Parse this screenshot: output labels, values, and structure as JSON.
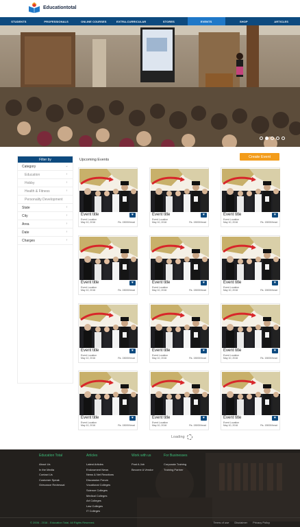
{
  "brand": {
    "name": "Educationtotal"
  },
  "nav": {
    "items": [
      {
        "label": "STUDENTS"
      },
      {
        "label": "PROFESSIONALS"
      },
      {
        "label": "ONLINE COURSES"
      },
      {
        "label": "EXTRA-CURRICULAR"
      },
      {
        "label": "STORES"
      },
      {
        "label": "EVENTS"
      },
      {
        "label": "SHOP"
      },
      {
        "label": "ARTICLES"
      }
    ],
    "active": "EVENTS"
  },
  "hero": {
    "slides": 5,
    "active_slide": 2
  },
  "sidebar": {
    "heading": "Filter by",
    "items": [
      {
        "label": "Category",
        "type": "main"
      },
      {
        "label": "Education",
        "type": "sub"
      },
      {
        "label": "Hobby",
        "type": "sub"
      },
      {
        "label": "Health & Fitness",
        "type": "sub"
      },
      {
        "label": "Personality Development",
        "type": "sub"
      },
      {
        "label": "State",
        "type": "main"
      },
      {
        "label": "City",
        "type": "main"
      },
      {
        "label": "Area",
        "type": "main"
      },
      {
        "label": "Date",
        "type": "main"
      },
      {
        "label": "Charges",
        "type": "main"
      }
    ]
  },
  "events": {
    "heading": "Upcoming Events",
    "create_label": "Create Event",
    "cards": [
      {
        "title": "Event title",
        "location": "Event Location",
        "date": "May 10, 2016",
        "price": "Rs. 15000/head"
      },
      {
        "title": "Event title",
        "location": "Event Location",
        "date": "May 10, 2016",
        "price": "Rs. 15000/head"
      },
      {
        "title": "Event title",
        "location": "Event Location",
        "date": "May 10, 2016",
        "price": "Rs. 15000/head"
      },
      {
        "title": "Event title",
        "location": "Event Location",
        "date": "May 10, 2016",
        "price": "Rs. 15000/head"
      },
      {
        "title": "Event title",
        "location": "Event Location",
        "date": "May 10, 2016",
        "price": "Rs. 15000/head"
      },
      {
        "title": "Event title",
        "location": "Event Location",
        "date": "May 10, 2016",
        "price": "Rs. 15000/head"
      },
      {
        "title": "Event title",
        "location": "Event Location",
        "date": "May 10, 2016",
        "price": "Rs. 15000/head"
      },
      {
        "title": "Event title",
        "location": "Event Location",
        "date": "May 10, 2016",
        "price": "Rs. 15000/head"
      },
      {
        "title": "Event title",
        "location": "Event Location",
        "date": "May 10, 2016",
        "price": "Rs. 15000/head"
      },
      {
        "title": "Event title",
        "location": "Event Location",
        "date": "May 10, 2016",
        "price": "Rs. 15000/head"
      },
      {
        "title": "Event title",
        "location": "Event Location",
        "date": "May 10, 2016",
        "price": "Rs. 15000/head"
      },
      {
        "title": "Event title",
        "location": "Event Location",
        "date": "May 10, 2016",
        "price": "Rs. 15000/head"
      }
    ],
    "loading_label": "Loading"
  },
  "footer": {
    "columns": [
      {
        "heading": "Education Total",
        "links": [
          "About Us",
          "In the Media",
          "Contact Us",
          "Customer Speak",
          "Grievance Redressal"
        ]
      },
      {
        "heading": "Articles",
        "links": [
          "Latest Articles",
          "Endowment News",
          "News & Net Reactions",
          "Discussion Forum",
          "Vocational Colleges",
          "Science Colleges",
          "Medical Colleges",
          "Art Colleges",
          "Law Colleges",
          "IT Colleges"
        ]
      },
      {
        "heading": "Work with us",
        "links": [
          "Post A Job",
          "Become A Vendor"
        ]
      },
      {
        "heading": "For Businesses",
        "links": [
          "Corporate Training",
          "Training Partner"
        ]
      }
    ],
    "copyright": "© 2006 - 2016 - Education Total. All Rights Reserved.",
    "bottom_links": [
      "Terms of use",
      "Disclaimer",
      "Privacy Policy"
    ]
  },
  "colors": {
    "nav": "#0d4a7f",
    "nav_active": "#1f78c8",
    "accent": "#f39c1a",
    "footer_heading": "#3dbf7a"
  }
}
